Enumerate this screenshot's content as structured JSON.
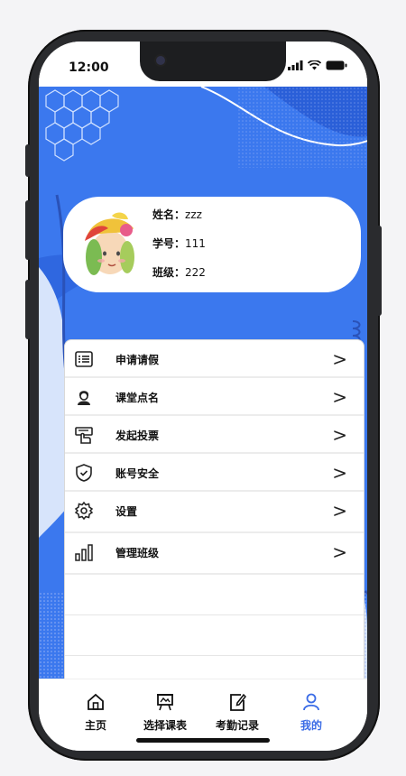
{
  "status_bar": {
    "time": "12:00"
  },
  "profile": {
    "name_label": "姓名：",
    "name_value": "zzz",
    "student_id_label": "学号：",
    "student_id_value": "111",
    "class_label": "班级：",
    "class_value": "222"
  },
  "menu": {
    "items": [
      {
        "label": "申请请假",
        "icon": "list-icon"
      },
      {
        "label": "课堂点名",
        "icon": "person-icon"
      },
      {
        "label": "发起投票",
        "icon": "vote-icon"
      },
      {
        "label": "账号安全",
        "icon": "shield-icon"
      },
      {
        "label": "设置",
        "icon": "gear-icon"
      },
      {
        "label": "管理班级",
        "icon": "bar-chart-icon"
      }
    ],
    "chevron": ">"
  },
  "tabbar": {
    "tabs": [
      {
        "label": "主页",
        "icon": "home-icon"
      },
      {
        "label": "选择课表",
        "icon": "easel-icon"
      },
      {
        "label": "考勤记录",
        "icon": "note-edit-icon"
      },
      {
        "label": "我的",
        "icon": "user-icon",
        "active": true
      }
    ]
  },
  "colors": {
    "accent": "#3b6ce6",
    "hero_blue": "#3b78ee"
  }
}
